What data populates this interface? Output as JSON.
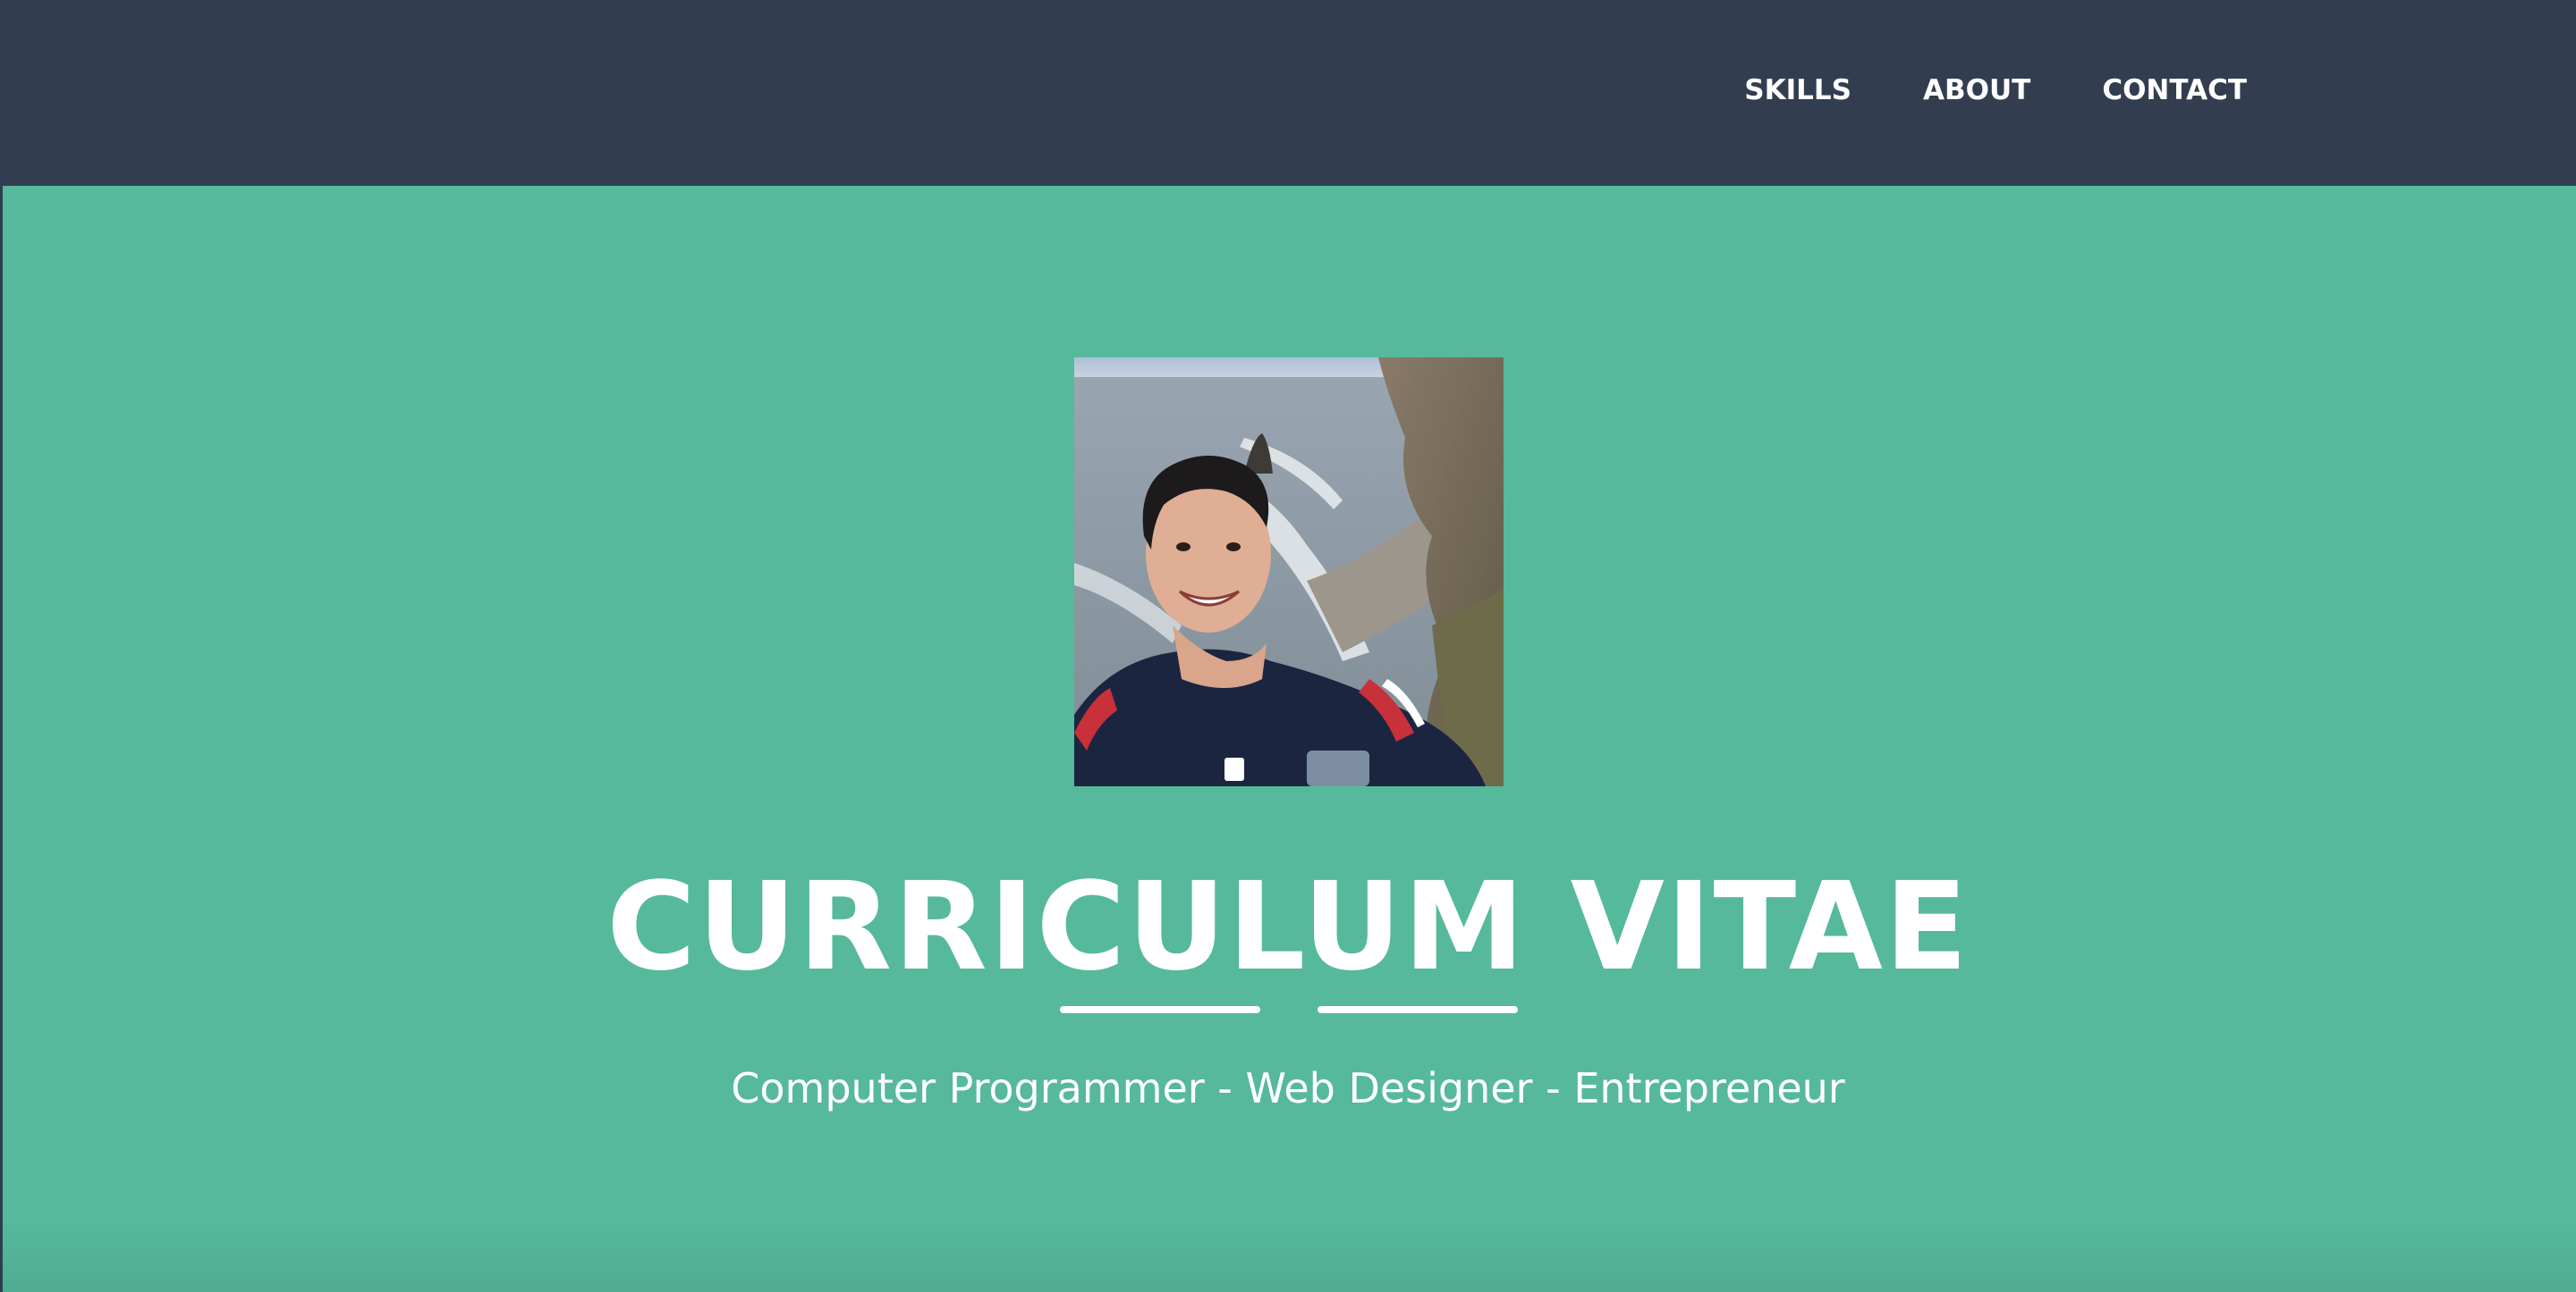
{
  "nav": {
    "items": [
      {
        "label": "SKILLS"
      },
      {
        "label": "ABOUT"
      },
      {
        "label": "CONTACT"
      }
    ]
  },
  "hero": {
    "title": "CURRICULUM VITAE",
    "subtitle": "Computer Programmer - Web Designer - Entrepreneur",
    "photo_icon": "profile-photo"
  },
  "colors": {
    "navbar": "#323e50",
    "hero_background": "#56b99c",
    "text": "#ffffff"
  }
}
